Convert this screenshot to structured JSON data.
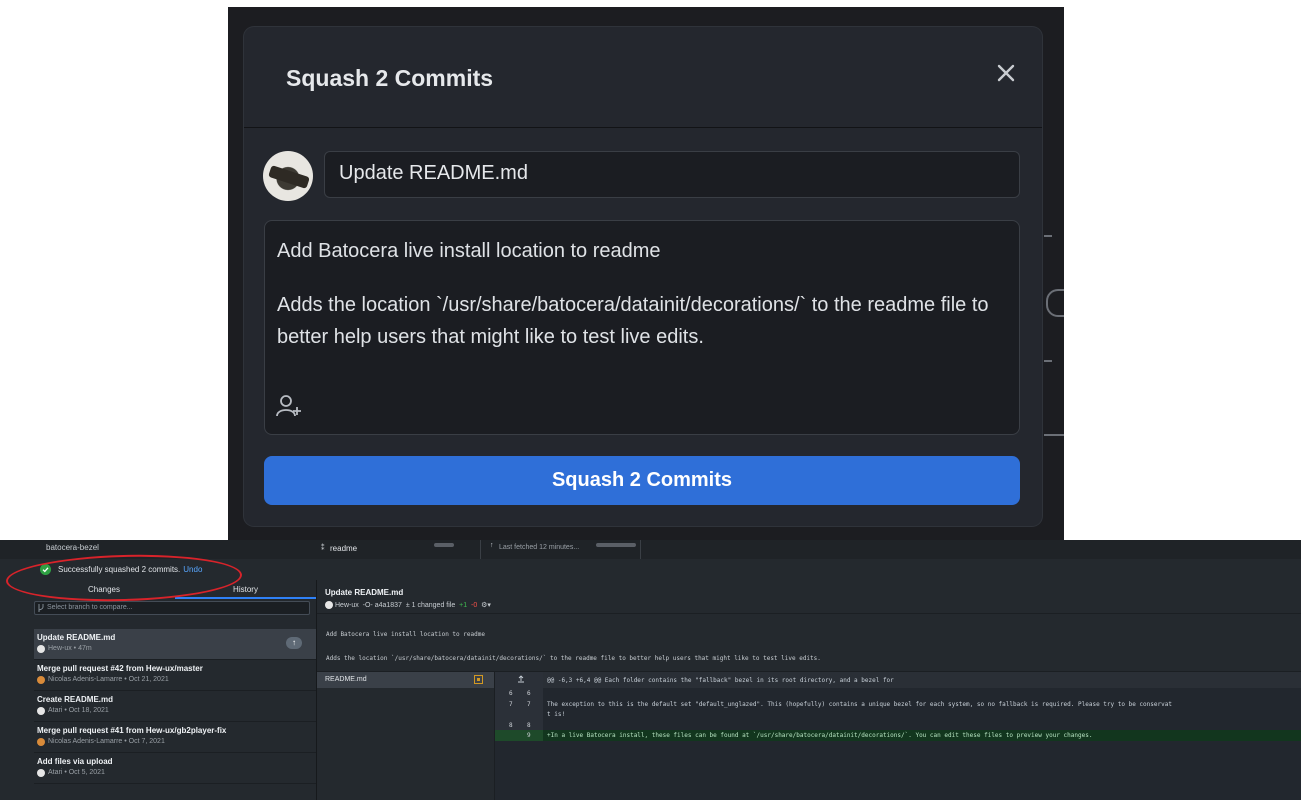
{
  "dialog": {
    "title": "Squash 2 Commits",
    "summary_value": "Update README.md",
    "description_line1": "Add Batocera live install location to readme",
    "description_line2": "Adds the location `/usr/share/batocera/datainit/decorations/` to the readme file to better help users that might like to test live edits.",
    "submit_label": "Squash 2 Commits",
    "colors": {
      "primary_button": "#2f6fd8",
      "dialog_bg": "#24272e"
    }
  },
  "toolbar": {
    "repo_name": "batocera-bezel",
    "branch": "readme",
    "fetch_status": "Last fetched 12 minutes..."
  },
  "banner": {
    "message": "Successfully squashed 2 commits.",
    "undo_label": "Undo",
    "annotation_color": "#d8232a"
  },
  "sidebar": {
    "tabs": {
      "changes": "Changes",
      "history": "History"
    },
    "branch_compare_placeholder": "Select branch to compare...",
    "commits": [
      {
        "title": "Update README.md",
        "meta": "Hew-ux • 47m",
        "badge": "↑"
      },
      {
        "title": "Merge pull request #42 from Hew-ux/master",
        "meta": "Nicolas Adenis-Lamarre • Oct 21, 2021"
      },
      {
        "title": "Create README.md",
        "meta": "Atari • Oct 18, 2021"
      },
      {
        "title": "Merge pull request #41 from Hew-ux/gb2player-fix",
        "meta": "Nicolas Adenis-Lamarre • Oct 7, 2021"
      },
      {
        "title": "Add files via upload",
        "meta": "Atari • Oct 5, 2021"
      }
    ]
  },
  "detail": {
    "title": "Update README.md",
    "author": "Hew-ux",
    "sha": "a4a1837",
    "changed_files": "1 changed file",
    "additions": "+1",
    "deletions": "-0",
    "message_line1": "Add Batocera live install location to readme",
    "message_line2": "Adds the location `/usr/share/batocera/datainit/decorations/` to the readme file to better help users that might like to test live edits.",
    "files": [
      {
        "name": "README.md"
      }
    ],
    "diff": {
      "hunk": "@@ -6,3 +6,4 @@ Each folder contains the \"fallback\" bezel in its root directory, and a bezel for",
      "lines": [
        {
          "old": "6",
          "new": "6",
          "text": ""
        },
        {
          "old": "7",
          "new": "7",
          "text": " The exception to this is the default set \"default_unglazed\". This (hopefully) contains a unique bezel for each system, so no fallback is required. Please try to be conservat"
        },
        {
          "old": "",
          "new": "",
          "text": "t is!"
        },
        {
          "old": "8",
          "new": "8",
          "text": ""
        },
        {
          "old": "",
          "new": "9",
          "text": "+In a live Batocera install, these files can be found at `/usr/share/batocera/datainit/decorations/`. You can edit these files to preview your changes."
        }
      ]
    }
  }
}
